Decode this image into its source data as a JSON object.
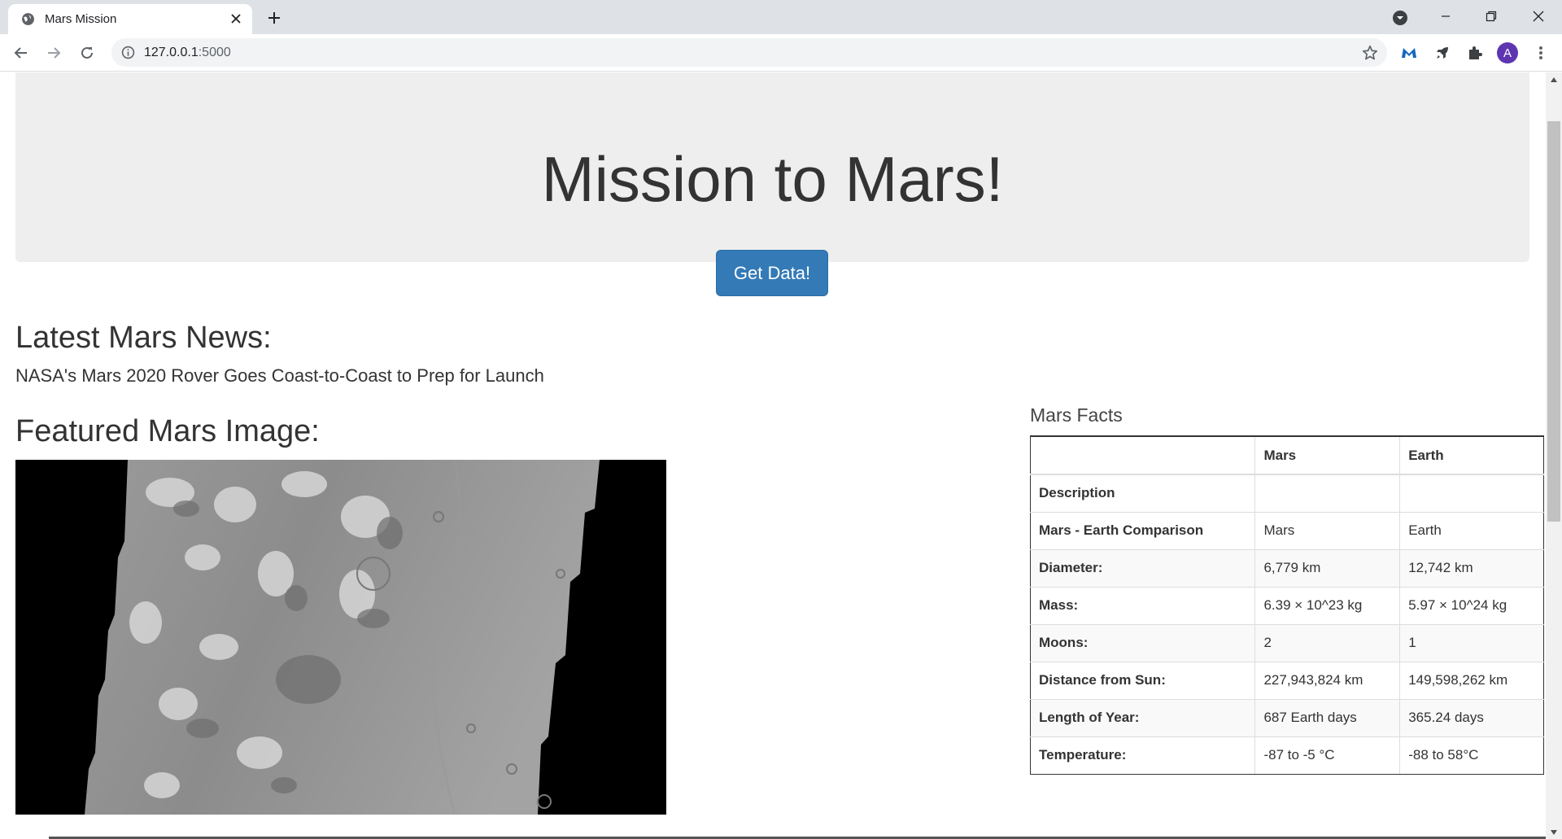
{
  "browser": {
    "tab_title": "Mars Mission",
    "url_host": "127.0.0.1",
    "url_port": ":5000",
    "avatar_letter": "A",
    "accent_color": "#5e35b1"
  },
  "jumbotron": {
    "title": "Mission to Mars!",
    "button_label": "Get Data!",
    "button_color": "#337ab7"
  },
  "news": {
    "heading": "Latest Mars News:",
    "title": "NASA's Mars 2020 Rover Goes Coast-to-Coast to Prep for Launch"
  },
  "featured_image": {
    "heading": "Featured Mars Image:"
  },
  "facts": {
    "caption": "Mars Facts",
    "columns": [
      "",
      "Mars",
      "Earth"
    ],
    "rows": [
      {
        "label": "Description",
        "mars": "",
        "earth": ""
      },
      {
        "label": "Mars - Earth Comparison",
        "mars": "Mars",
        "earth": "Earth"
      },
      {
        "label": "Diameter:",
        "mars": "6,779 km",
        "earth": "12,742 km"
      },
      {
        "label": "Mass:",
        "mars": "6.39 × 10^23 kg",
        "earth": "5.97 × 10^24 kg"
      },
      {
        "label": "Moons:",
        "mars": "2",
        "earth": "1"
      },
      {
        "label": "Distance from Sun:",
        "mars": "227,943,824 km",
        "earth": "149,598,262 km"
      },
      {
        "label": "Length of Year:",
        "mars": "687 Earth days",
        "earth": "365.24 days"
      },
      {
        "label": "Temperature:",
        "mars": "-87 to -5 °C",
        "earth": "-88 to 58°C"
      }
    ]
  }
}
